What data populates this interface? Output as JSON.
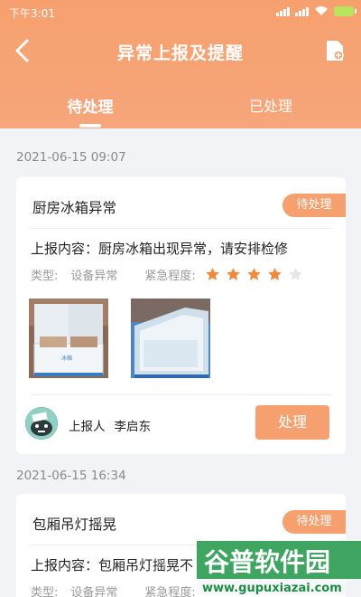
{
  "status_bar": {
    "time": "下午3:01"
  },
  "header": {
    "title": "异常上报及提醒"
  },
  "tabs": [
    {
      "label": "待处理",
      "active": true
    },
    {
      "label": "已处理",
      "active": false
    }
  ],
  "reports": [
    {
      "date": "2021-06-15 09:07",
      "title": "厨房冰箱异常",
      "status": "待处理",
      "content": "上报内容：厨房冰箱出现异常，请安排检修",
      "type_label": "类型:",
      "type_value": "设备异常",
      "urgency_label": "紧急程度:",
      "urgency_stars": 4,
      "urgency_max": 5,
      "reporter_label": "上报人",
      "reporter_name": "李启东",
      "action_label": "处理"
    },
    {
      "date": "2021-06-15 16:34",
      "title": "包厢吊灯摇晃",
      "status": "待处理",
      "content": "上报内容：包厢吊灯摇晃不",
      "type_label": "类型:",
      "type_value": "设备异常",
      "urgency_label": "紧急程度:"
    }
  ],
  "watermark": {
    "brand": "谷普软件园",
    "url": "www.gupuxiazai.com"
  },
  "colors": {
    "accent": "#f7a06f",
    "star_on": "#f08a3c",
    "star_off": "#e6e6e6"
  }
}
